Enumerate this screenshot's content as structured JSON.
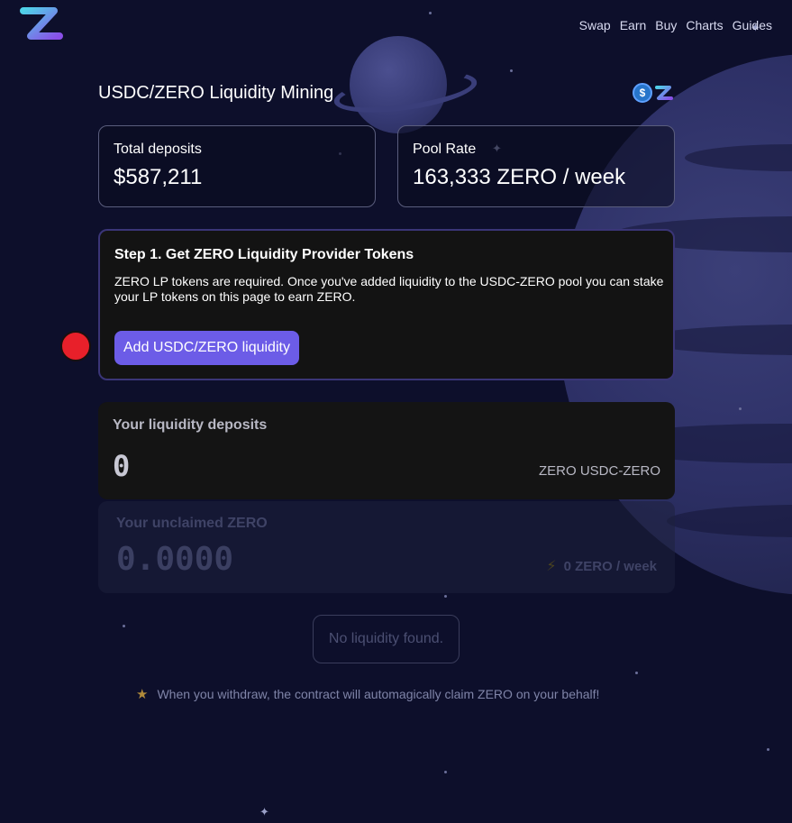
{
  "nav": {
    "items": [
      "Swap",
      "Earn",
      "Buy",
      "Charts",
      "Guides"
    ]
  },
  "header": {
    "title": "USDC/ZERO Liquidity Mining",
    "token_a_symbol": "$"
  },
  "stats": {
    "total_deposits_label": "Total deposits",
    "total_deposits_value": "$587,211",
    "pool_rate_label": "Pool Rate",
    "pool_rate_value": "163,333 ZERO / week"
  },
  "step": {
    "title": "Step 1. Get ZERO Liquidity Provider Tokens",
    "description": "ZERO LP tokens are required. Once you've added liquidity to the USDC-ZERO pool you can stake your LP tokens on this page to earn ZERO.",
    "button_label": "Add USDC/ZERO liquidity"
  },
  "deposits": {
    "label": "Your liquidity deposits",
    "value": "0",
    "unit": "ZERO USDC-ZERO"
  },
  "unclaimed": {
    "label": "Your unclaimed ZERO",
    "value": "0.0000",
    "rate": "0 ZERO / week"
  },
  "status": {
    "no_liquidity": "No liquidity found."
  },
  "footer": {
    "note": "When you withdraw, the contract will automagically claim ZERO on your behalf!"
  },
  "colors": {
    "background": "#0d0f2b",
    "accent": "#6c5ce7",
    "usdc": "#2775ca",
    "indicator": "#e8202a"
  },
  "icons": {
    "logo": "zero-logo-icon",
    "usdc": "usdc-token-icon",
    "zero": "zero-token-icon",
    "bolt": "lightning-icon",
    "star": "star-icon"
  }
}
